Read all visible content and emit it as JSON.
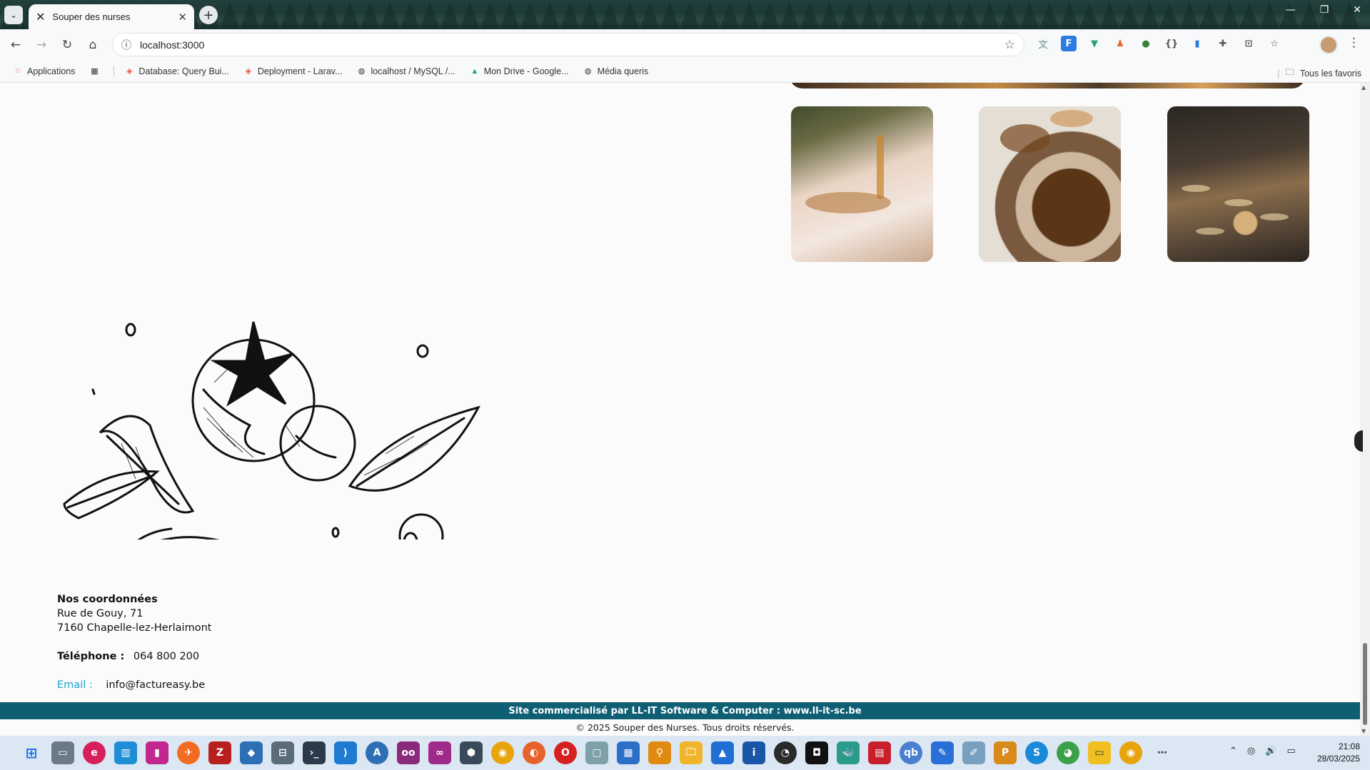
{
  "browser": {
    "tab_title": "Souper des nurses",
    "url": "localhost:3000",
    "bookmarks": [
      {
        "label": "Applications",
        "icon": "apps-grid-icon"
      },
      {
        "label": "Database: Query Bui...",
        "icon": "laravel-icon"
      },
      {
        "label": "Deployment - Larav...",
        "icon": "laravel-icon"
      },
      {
        "label": "localhost / MySQL /...",
        "icon": "globe-icon"
      },
      {
        "label": "Mon Drive - Google...",
        "icon": "google-drive-icon"
      },
      {
        "label": "Média queris",
        "icon": "globe-icon"
      }
    ],
    "all_bookmarks_label": "Tous les favoris"
  },
  "gallery": {
    "photos": [
      {
        "name": "photo-plated-dish",
        "alt_icon": "plate-sauce-photo"
      },
      {
        "name": "photo-onion-soup",
        "alt_icon": "soup-bread-photo"
      },
      {
        "name": "photo-dinner-table",
        "alt_icon": "people-dining-photo"
      }
    ]
  },
  "contact": {
    "heading": "Nos coordonnées",
    "address_line1": "Rue de Gouy, 71",
    "address_line2": "7160 Chapelle-lez-Herlaimont",
    "phone_label": "Téléphone :",
    "phone_value": "064 800 200",
    "email_label": "Email :",
    "email_value": "info@factureasy.be"
  },
  "footer": {
    "commercial": "Site commercialisé par LL-IT Software & Computer : www.ll-it-sc.be",
    "copyright": "© 2025 Souper des Nurses. Tous droits réservés."
  },
  "taskbar": {
    "time": "21:08",
    "date": "28/03/2025"
  },
  "colors": {
    "footer_bar": "#0e5f74",
    "email_label": "#1aa3c7",
    "page_bg": "#fbfbfb"
  }
}
